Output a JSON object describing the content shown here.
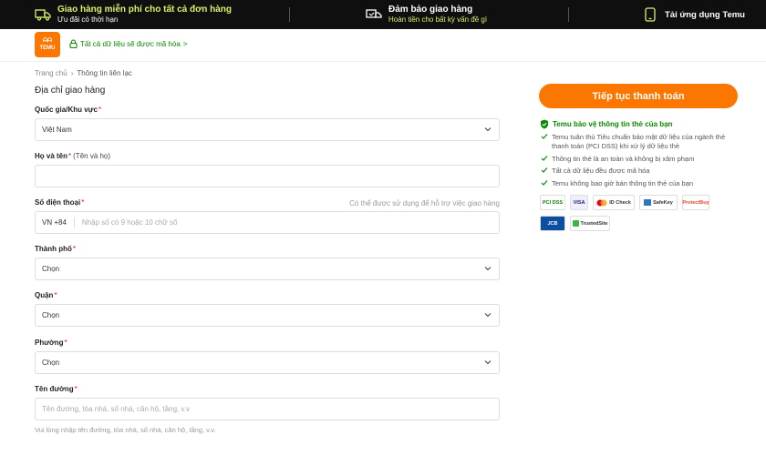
{
  "banner": {
    "free_shipping_title": "Giao hàng miễn phí cho tất cả đơn hàng",
    "free_shipping_sub": "Ưu đãi có thời hạn",
    "delivery_title": "Đảm bảo giao hàng",
    "delivery_sub": "Hoàn tiền cho bất kỳ vấn đề gì",
    "app_label": "Tải ứng dụng Temu"
  },
  "header": {
    "logo_line1": "ᗩᗩ",
    "logo_line2": "TEMU",
    "secure_note": "Tất cả dữ liệu sẽ được mã hóa",
    "secure_arrow": ">"
  },
  "breadcrumb": {
    "home": "Trang chủ",
    "sep": "›",
    "current": "Thông tin liên lạc"
  },
  "form": {
    "section_title": "Địa chỉ giao hàng",
    "country_label": "Quốc gia/Khu vực",
    "country_value": "Việt Nam",
    "name_label": "Họ và tên",
    "name_hint": "(Tên và họ)",
    "phone_label": "Số điện thoại",
    "phone_right_hint": "Có thể được sử dụng để hỗ trợ việc giao hàng",
    "phone_prefix": "VN +84",
    "phone_placeholder": "Nhập số có 9 hoặc 10 chữ số",
    "city_label": "Thành phố",
    "city_value": "Chọn",
    "district_label": "Quận",
    "district_value": "Chọn",
    "ward_label": "Phường",
    "ward_value": "Chọn",
    "street_label": "Tên đường",
    "street_placeholder": "Tên đường, tòa nhà, số nhà, căn hộ, tầng, v.v",
    "street_help": "Vui lòng nhập tên đường, tòa nhà, số nhà, căn hộ, tầng, v.v.",
    "required_mark": "*"
  },
  "side": {
    "pay_button": "Tiếp tục thanh toán",
    "protect_title": "Temu bảo vệ thông tin thẻ của bạn",
    "protect_items": [
      "Temu tuân thủ Tiêu chuẩn bảo mật dữ liệu của ngành thẻ thanh toán (PCI DSS) khi xử lý dữ liệu thẻ",
      "Thông tin thẻ là an toàn và không bị xâm phạm",
      "Tất cả dữ liệu đều được mã hóa",
      "Temu không bao giờ bán thông tin thẻ của bạn"
    ],
    "badges": [
      "PCI DSS",
      "VISA",
      "ID Check",
      "SafeKey",
      "ProtectBuy",
      "JCB",
      "TrustedSite"
    ]
  },
  "colors": {
    "accent": "#fb7701",
    "secure_green": "#0a8a00",
    "banner_bg": "#0f0f0f",
    "banner_highlight": "#d6f36b"
  }
}
